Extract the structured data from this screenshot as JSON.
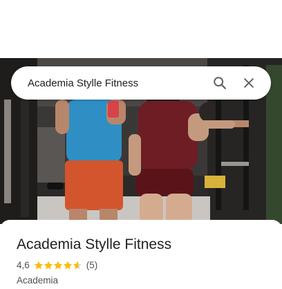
{
  "search": {
    "query": "Academia Stylle Fitness",
    "search_icon": "search-icon",
    "close_icon": "close-icon"
  },
  "place": {
    "name": "Academia Stylle Fitness",
    "rating": "4,6",
    "rating_value": 4.6,
    "stars_max": 5,
    "review_count": "(5)",
    "category": "Academia"
  },
  "colors": {
    "star": "#fbbc04",
    "star_empty": "#dadce0",
    "text_primary": "#202124",
    "text_secondary": "#4d5156",
    "icon": "#5f6368"
  }
}
